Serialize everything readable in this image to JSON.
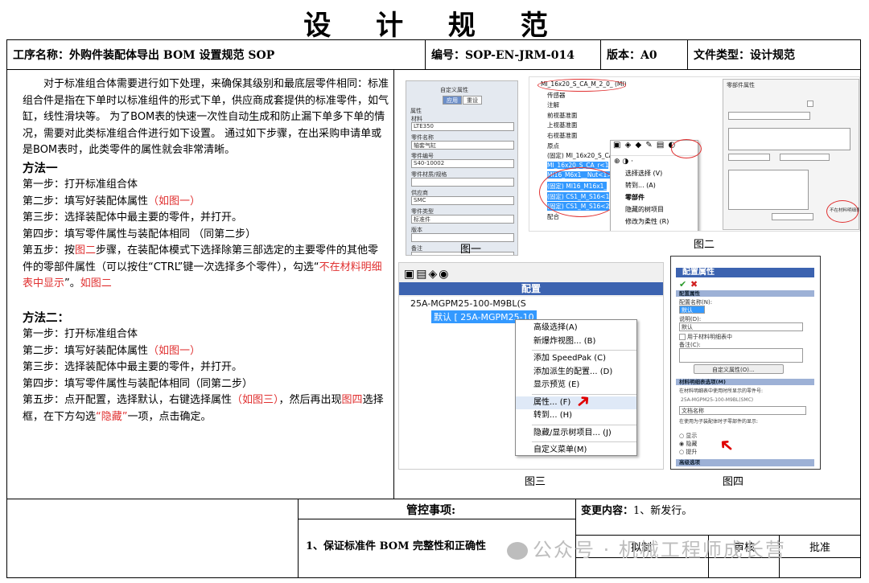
{
  "title": "设 计 规 范",
  "header": {
    "process_name": "工序名称：外购件装配体导出 BOM 设置规范  SOP",
    "code": "编号：SOP-EN-JRM-014",
    "version": "版本：A0",
    "doc_type": "文件类型：设计规范"
  },
  "body": {
    "intro": "对于标准组合体需要进行如下处理，来确保其级别和最底层零件相同：标准组合件是指在下单时以标准组件的形式下单，供应商成套提供的标准零件，如气缸，线性滑块等。 为了BOM表的快速一次性自动生成和防止漏下单多下单的情况，需要对此类标准组合件进行如下设置。 通过如下步骤，在出采购申请单或是BOM表时，此类零件的属性就会非常清晰。",
    "method1_title": "方法一",
    "m1_s1": "第一步：打开标准组合体",
    "m1_s2a": "第二步：填写好装配体属性",
    "m1_s2b": "（如图一）",
    "m1_s3": "第三步：选择装配体中最主要的零件，并打开。",
    "m1_s4": "第四步：填写零件属性与装配体相同  （同第二步）",
    "m1_s5a": "第五步：按",
    "m1_s5b": "图二",
    "m1_s5c": "步骤，在装配体模式下选择除第三部选定的主要零件的其他零件的零部件属性（可以按住“CTRL”键一次选择多个零件），勾选“",
    "m1_s5d": "不在材料明细表中显示",
    "m1_s5e": "”。",
    "m1_s5f": "如图二",
    "method2_title": "方法二：",
    "m2_s1": "第一步：打开标准组合体",
    "m2_s2a": "第二步：填写好装配体属性",
    "m2_s2b": "（如图一）",
    "m2_s3": "第三步：选择装配体中最主要的零件，并打开。",
    "m2_s4": "第四步：填写零件属性与装配体相同（同第二步）",
    "m2_s5a": "第五步：点开配置，选择默认，右键选择属性",
    "m2_s5b": "（如图三）",
    "m2_s5c": "，然后再出现",
    "m2_s5d": "图四",
    "m2_s5e": "选择框，在下方勾选",
    "m2_s5f": "“隐藏”",
    "m2_s5g": "一项，点击确定。"
  },
  "figures": {
    "fig1": {
      "caption": "图一",
      "panel_title": "自定义属性",
      "btn_apply": "应用",
      "btn_cancel": "重设",
      "props_label": "属性",
      "fields": [
        {
          "label": "材料",
          "value": "LTE350"
        },
        {
          "label": "零件名称",
          "value": "轴套气缸"
        },
        {
          "label": "零件编号",
          "value": "S40-10002"
        },
        {
          "label": "零件材质/规格",
          "value": ""
        },
        {
          "label": "供应商",
          "value": "SMC"
        },
        {
          "label": "零件类型",
          "value": "标准件"
        },
        {
          "label": "版本",
          "value": ""
        },
        {
          "label": "备注",
          "value": ""
        }
      ]
    },
    "fig2": {
      "caption": "图二",
      "tree": [
        "MI_16x20_S_CA_M_2_0_ (MI)",
        "传感器",
        "注解",
        "前视基准面",
        "上视基准面",
        "右视基准面",
        "原点",
        "(固定) MI_16x20_S_CA_M",
        "MI_16x20_S_CA_r<1",
        "MI16_M6x1__Nut<1>",
        "(固定) MI16_M16x1_",
        "(固定) CS1_M_S16<1",
        "(固定) CS1_M_S16<2",
        "配合"
      ],
      "menu": [
        "选择选择 (V)",
        "转到... (A)",
        "零部件",
        "隐藏的树项目",
        "修改为柔性 (R)"
      ],
      "dialog_title": "零部件属性",
      "dialog_check": "不在材料明细表中显示"
    },
    "fig3": {
      "caption": "图三",
      "panel_label": "配置",
      "tree_root": "25A-MGPM25-100-M9BL(S",
      "tree_child": "默认 [ 25A-MGPM25-10",
      "menu": [
        "高级选择(A)",
        "新爆炸视图... (B)",
        "添加 SpeedPak (C)",
        "添加派生的配置... (D)",
        "显示预览 (E)",
        "属性... (F)",
        "转到... (H)",
        "隐藏/显示树项目... (J)",
        "自定义菜单(M)"
      ]
    },
    "fig4": {
      "caption": "图四",
      "panel_title": "配置属性",
      "sec1": "配置属性",
      "name_label": "配置名称(N):",
      "name_value": "默认",
      "desc_label": "说明(D):",
      "desc_value": "默认",
      "bom_check": "用于材料明细表中",
      "comment_label": "备注(C):",
      "custom_btn": "自定义属性(O)...",
      "sec2": "材料明细表选项(M)",
      "bom_text": "在材料明细表中使用时所显示的零件号:",
      "bom_value": "25A-MGPM25-100-M9BL(SMC)",
      "doc_name": "文档名称",
      "sub_text": "在使用为子装配体时子零部件的显示:",
      "opt_show": "显示",
      "opt_hide": "隐藏",
      "opt_promote": "提升",
      "sec3": "高级选项"
    }
  },
  "footer": {
    "control_label": "管控事项:",
    "change_label": "变更内容：",
    "change_value": "1、新发行。",
    "control_item": "1、保证标准件 BOM 完整性和正确性",
    "drafted": "拟制",
    "reviewed": "审核",
    "approved": "批准",
    "watermark": "公众号 · 机械工程师成长营"
  },
  "colors": {
    "red": "#e03030",
    "blue_bar": "#3c63b0",
    "select_blue": "#3399ff"
  }
}
